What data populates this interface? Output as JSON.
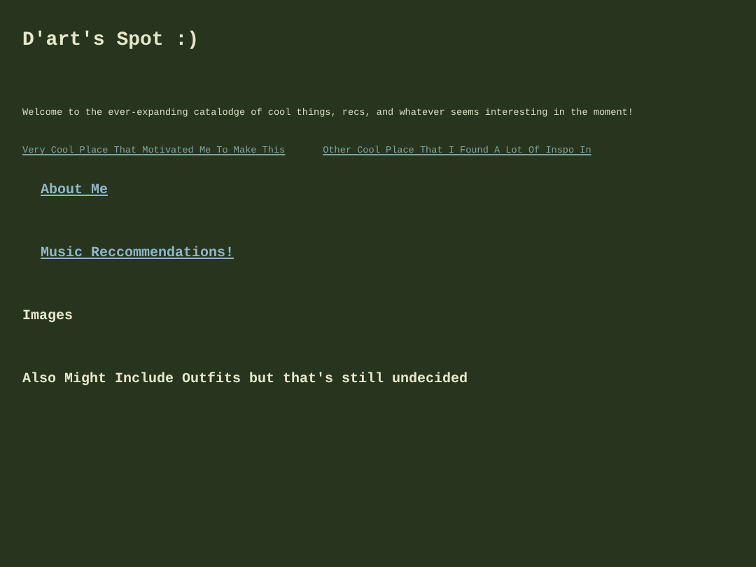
{
  "title": "D'art's Spot :)",
  "intro": "Welcome to the ever-expanding catalodge of cool things, recs, and whatever seems interesting in the moment!",
  "links": [
    "Very Cool Place That Motivated Me To Make This",
    "Other Cool Place That I Found A Lot Of Inspo In"
  ],
  "sections": [
    {
      "kind": "link",
      "label": "About Me"
    },
    {
      "kind": "link",
      "label": "Music Reccommendations!"
    },
    {
      "kind": "heading",
      "label": "Images"
    },
    {
      "kind": "heading",
      "label": "Also Might Include Outfits but that's still undecided"
    }
  ]
}
